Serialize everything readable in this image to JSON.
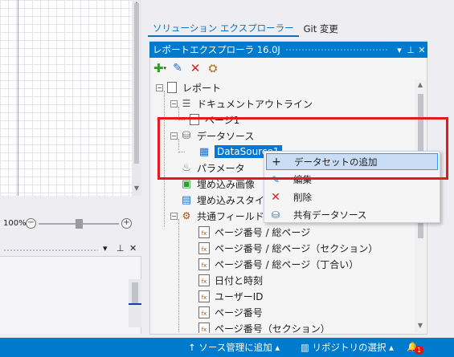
{
  "designer": {
    "zoom_level": "100%",
    "zoom_minus": "−",
    "zoom_plus": "+"
  },
  "tabs": [
    {
      "label": "ソリューション エクスプローラー"
    },
    {
      "label": "Git 変更"
    }
  ],
  "panel": {
    "title": "レポートエクスプローラ 16.0J",
    "controls": {
      "dropdown": "▾",
      "pin": "📌",
      "close": "✕"
    },
    "toolbar_icons": [
      "add-dropdown-icon",
      "edit-pencil-icon",
      "delete-icon",
      "group-icon"
    ]
  },
  "tree": [
    {
      "label": "レポート"
    },
    {
      "label": "ドキュメントアウトライン"
    },
    {
      "label": "ページ1"
    },
    {
      "label": "データソース"
    },
    {
      "label": "DataSource1"
    },
    {
      "label": "パラメータ"
    },
    {
      "label": "埋め込み画像"
    },
    {
      "label": "埋め込みスタイル"
    },
    {
      "label": "共通フィールド"
    },
    {
      "label": "ページ番号 / 総ページ"
    },
    {
      "label": "ページ番号 / 総ページ（セクション）"
    },
    {
      "label": "ページ番号 / 総ページ（丁合い）"
    },
    {
      "label": "日付と時刻"
    },
    {
      "label": "ユーザーID"
    },
    {
      "label": "ページ番号"
    },
    {
      "label": "ページ番号（セクション）"
    }
  ],
  "context_menu": {
    "items": [
      {
        "label": "データセットの追加",
        "icon": "plus-icon"
      },
      {
        "label": "編集",
        "icon": "edit-icon"
      },
      {
        "label": "削除",
        "icon": "delete-icon"
      },
      {
        "label": "共有データソース",
        "icon": "database-icon"
      }
    ]
  },
  "status_bar": {
    "source_control": "ソース管理に追加",
    "repository": "リポジトリの選択",
    "notification_count": "1"
  },
  "colors": {
    "accent": "#007acc",
    "highlight": "#e01b1b",
    "selection": "#0078d7"
  }
}
